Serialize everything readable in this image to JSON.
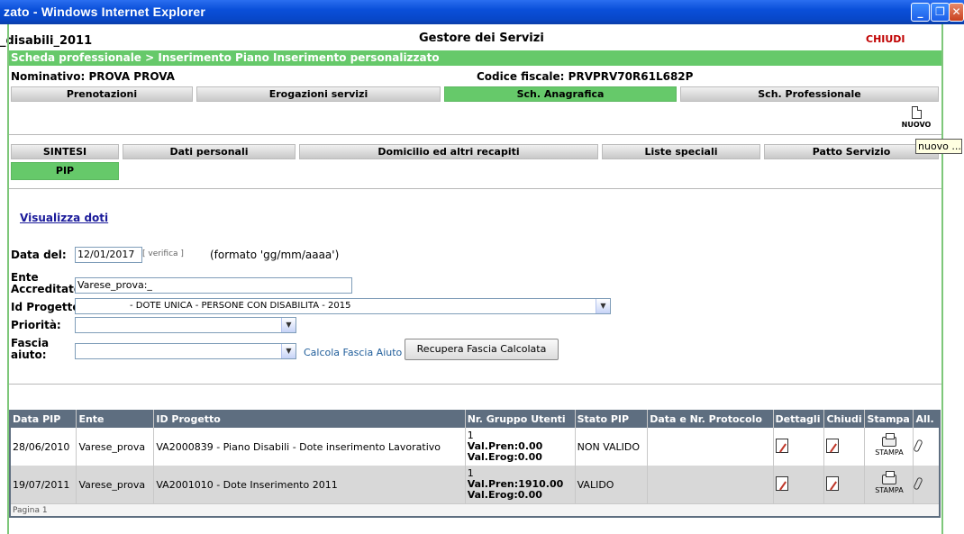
{
  "window": {
    "title": "zato - Windows Internet Explorer"
  },
  "header": {
    "left": "_disabili_2011",
    "center": "Gestore dei Servizi",
    "close": "CHIUDI"
  },
  "breadcrumb": "Scheda professionale > Inserimento Piano Inserimento personalizzato",
  "person": {
    "nominativo": "Nominativo:  PROVA  PROVA",
    "codice_fiscale": "Codice fiscale:  PRVPRV70R61L682P"
  },
  "main_tabs": [
    "Prenotazioni",
    "Erogazioni servizi",
    "Sch. Anagrafica",
    "Sch. Professionale"
  ],
  "new_button": {
    "label": "NUOVO",
    "tooltip": "nuovo ..."
  },
  "sub_tabs": [
    "SINTESI",
    "Dati personali",
    "Domicilio ed altri recapiti",
    "Liste speciali",
    "Patto Servizio",
    "PIP"
  ],
  "link_doti": "Visualizza doti",
  "form": {
    "data_label": "Data del:",
    "data_value": "12/01/2017",
    "verifica": "[ verifica ]",
    "format_note": "(formato 'gg/mm/aaaa')",
    "ente_label1": "Ente",
    "ente_label2": "Accreditato",
    "ente_value": "Varese_prova:_",
    "progetto_label": "Id Progetto",
    "progetto_value": "- DOTE UNICA - PERSONE CON DISABILITA - 2015",
    "priorita_label": "Priorità:",
    "fascia_label1": "Fascia",
    "fascia_label2": "aiuto:",
    "calcola": "Calcola Fascia Aiuto",
    "recupera": "Recupera Fascia Calcolata"
  },
  "table": {
    "headers": [
      "Data PIP",
      "Ente",
      "ID Progetto",
      "Nr. Gruppo Utenti",
      "Stato PIP",
      "Data e Nr. Protocolo",
      "Dettagli",
      "Chiudi",
      "Stampa",
      "All."
    ],
    "rows": [
      {
        "data": "28/06/2010",
        "ente": "Varese_prova",
        "progetto": "VA2000839 - Piano Disabili - Dote inserimento Lavorativo",
        "nr": "1",
        "pren": "Val.Pren:0.00",
        "erog": "Val.Erog:0.00",
        "stato": "NON VALIDO",
        "protocollo": "",
        "stampa": "STAMPA"
      },
      {
        "data": "19/07/2011",
        "ente": "Varese_prova",
        "progetto": "VA2001010 - Dote Inserimento 2011",
        "nr": "1",
        "pren": "Val.Pren:1910.00",
        "erog": "Val.Erog:0.00",
        "stato": "VALIDO",
        "protocollo": "",
        "stampa": "STAMPA"
      }
    ],
    "pager": "Pagina 1"
  }
}
